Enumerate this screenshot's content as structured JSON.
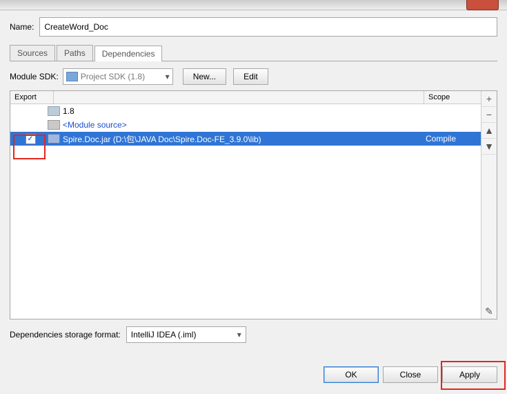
{
  "name_label": "Name:",
  "name_value": "CreateWord_Doc",
  "tabs": {
    "sources": "Sources",
    "paths": "Paths",
    "deps": "Dependencies"
  },
  "sdk": {
    "label": "Module SDK:",
    "value": "Project SDK (1.8)",
    "new": "New...",
    "edit": "Edit"
  },
  "list": {
    "hdr_export": "Export",
    "hdr_scope": "Scope",
    "rows": [
      {
        "label": "1.8",
        "scope": "",
        "kind": "sdk"
      },
      {
        "label": "<Module source>",
        "scope": "",
        "kind": "module"
      },
      {
        "label": "Spire.Doc.jar (D:\\包\\JAVA Doc\\Spire.Doc-FE_3.9.0\\lib)",
        "scope": "Compile",
        "kind": "jar",
        "checked": true,
        "selected": true
      }
    ]
  },
  "storage": {
    "label": "Dependencies storage format:",
    "value": "IntelliJ IDEA (.iml)"
  },
  "buttons": {
    "ok": "OK",
    "close": "Close",
    "apply": "Apply"
  },
  "side": {
    "add": "+",
    "remove": "−",
    "up": "▲",
    "down": "▼",
    "edit": "✎"
  }
}
